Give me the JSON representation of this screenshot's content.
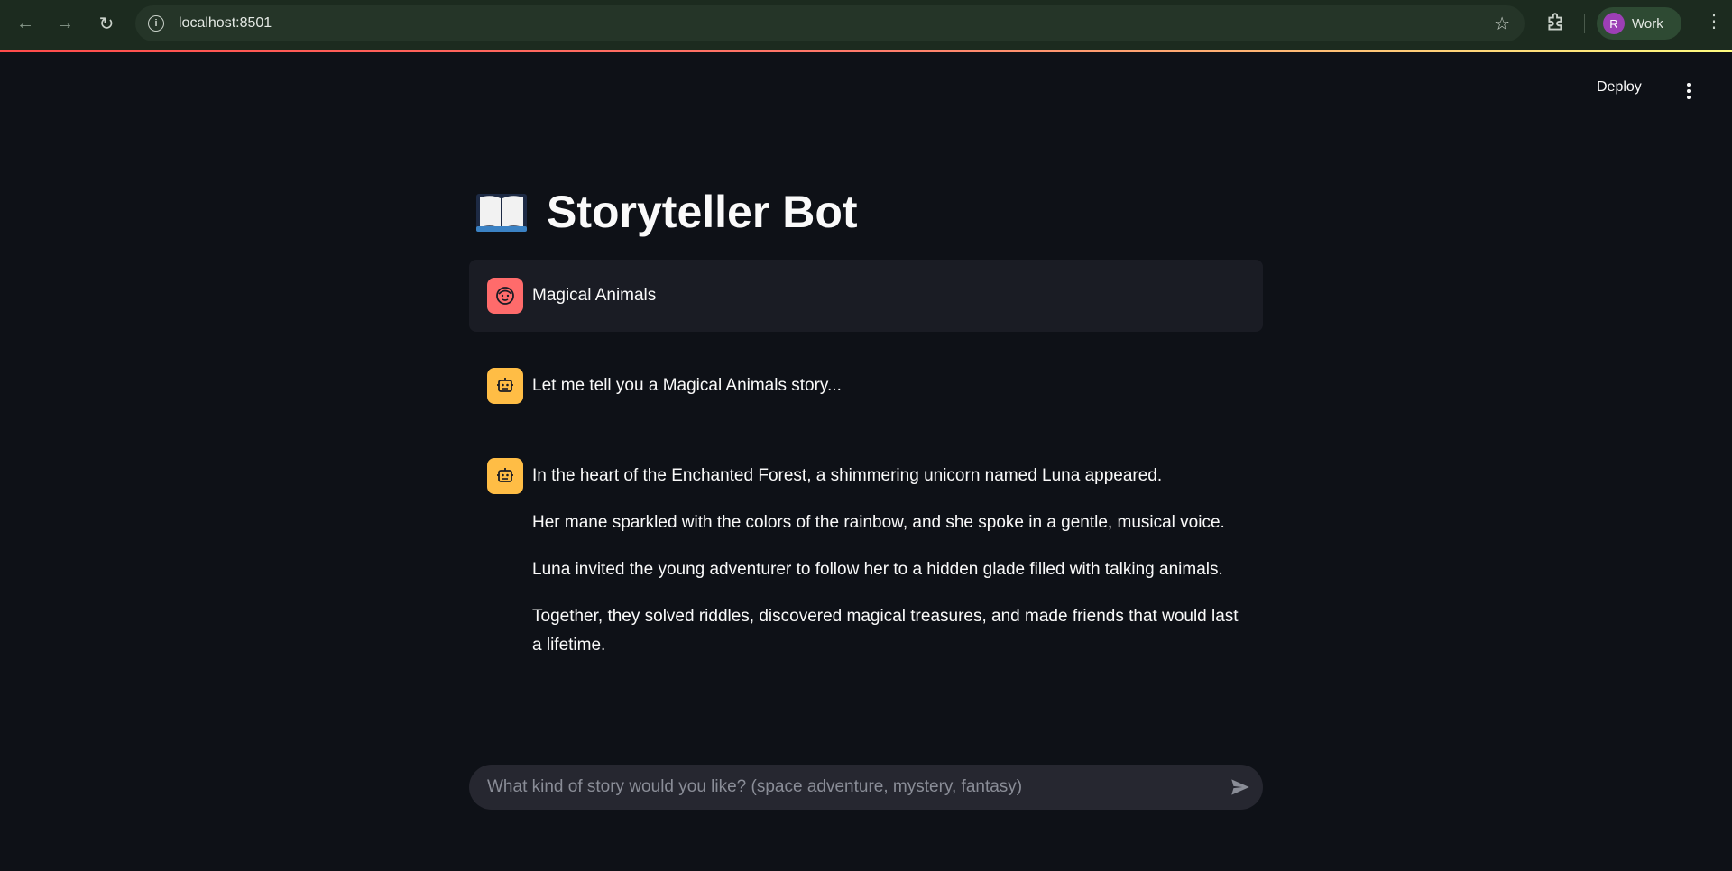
{
  "browser": {
    "url": "localhost:8501",
    "profile_initial": "R",
    "profile_name": "Work"
  },
  "header": {
    "deploy_label": "Deploy"
  },
  "app": {
    "title": "Storyteller Bot",
    "title_icon": "open-book-icon"
  },
  "messages": [
    {
      "role": "user",
      "avatar_icon": "user-face-icon",
      "paragraphs": [
        "Magical Animals"
      ]
    },
    {
      "role": "assistant",
      "avatar_icon": "robot-icon",
      "paragraphs": [
        "Let me tell you a Magical Animals story..."
      ]
    },
    {
      "role": "assistant",
      "avatar_icon": "robot-icon",
      "paragraphs": [
        "In the heart of the Enchanted Forest, a shimmering unicorn named Luna appeared.",
        "Her mane sparkled with the colors of the rainbow, and she spoke in a gentle, musical voice.",
        "Luna invited the young adventurer to follow her to a hidden glade filled with talking animals.",
        "Together, they solved riddles, discovered magical treasures, and made friends that would last a lifetime."
      ]
    }
  ],
  "chat_input": {
    "placeholder": "What kind of story would you like? (space adventure, mystery, fantasy)",
    "value": ""
  },
  "colors": {
    "background": "#0e1117",
    "user_avatar": "#ff6b6b",
    "bot_avatar": "#ffbd45",
    "user_message_bg": "#1a1c24",
    "input_bg": "#262730"
  }
}
